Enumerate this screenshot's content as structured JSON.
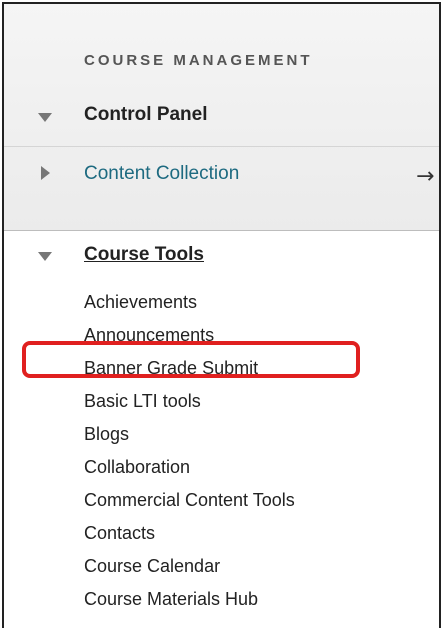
{
  "section_title": "COURSE MANAGEMENT",
  "control_panel": {
    "label": "Control Panel"
  },
  "content_collection": {
    "label": "Content Collection",
    "arrow_icon": "→"
  },
  "course_tools": {
    "label": "Course Tools",
    "items": [
      "Achievements",
      "Announcements",
      "Banner Grade Submit",
      "Basic LTI tools",
      "Blogs",
      "Collaboration",
      "Commercial Content Tools",
      "Contacts",
      "Course Calendar",
      "Course Materials Hub"
    ],
    "highlighted_item": "Banner Grade Submit",
    "highlight_color": "#e0201f"
  },
  "colors": {
    "link": "#1d6a80",
    "text": "#222222",
    "header_bg": "#f0f0f0"
  }
}
